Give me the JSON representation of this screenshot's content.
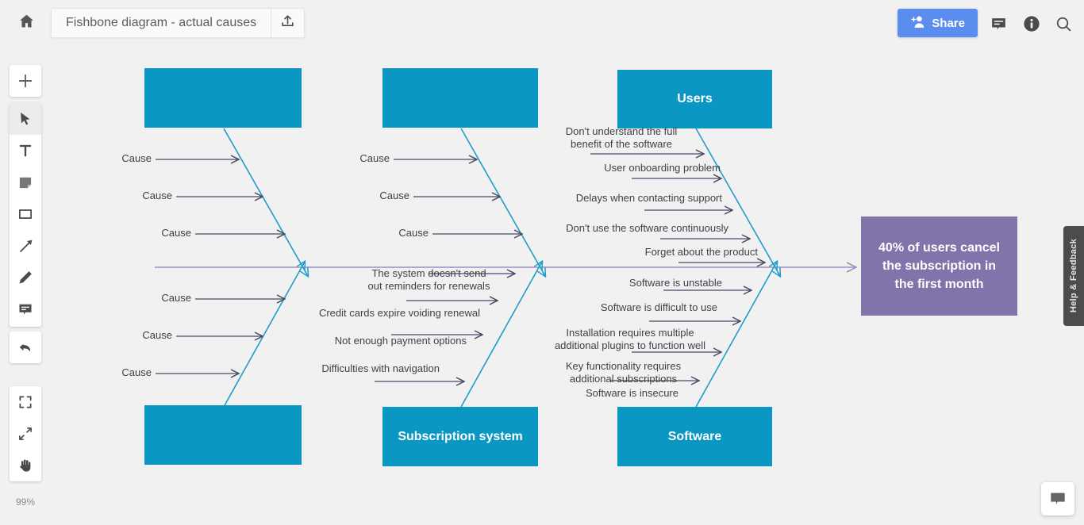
{
  "app": {
    "home_icon": "home-icon",
    "title": "Fishbone diagram - actual causes",
    "export_icon": "export-icon",
    "share_label": "Share",
    "share_icon": "add-person-icon",
    "comment_icon": "comment-icon",
    "info_icon": "info-icon",
    "search_icon": "search-icon",
    "accent_blue": "#5b8def"
  },
  "toolbar": {
    "add": {
      "name": "add-icon",
      "label": "+"
    },
    "tools": [
      {
        "name": "select-cursor-icon",
        "active": true
      },
      {
        "name": "text-tool-icon",
        "active": false
      },
      {
        "name": "sticky-note-icon",
        "active": false
      },
      {
        "name": "rectangle-shape-icon",
        "active": false
      },
      {
        "name": "arrow-tool-icon",
        "active": false
      },
      {
        "name": "pencil-tool-icon",
        "active": false
      },
      {
        "name": "comment-tool-icon",
        "active": false
      }
    ],
    "undo": {
      "name": "undo-icon"
    },
    "view": [
      {
        "name": "fit-to-screen-icon"
      },
      {
        "name": "expand-icon"
      },
      {
        "name": "pan-hand-icon"
      }
    ],
    "zoom_level": "99%"
  },
  "panels": {
    "help_tab": "Help & Feedback",
    "chat_fab_icon": "chat-bubble-icon"
  },
  "diagram": {
    "colors": {
      "category_box": "#0b97c4",
      "effect_box": "#8274ab",
      "bone": "#1e9dc8",
      "spine": "#9b8fc4",
      "cause_arrow": "#4a4a66"
    },
    "spine_label": "",
    "effect": {
      "text": "40% of users cancel the subscription in the first month",
      "lines": [
        "40% of users cancel",
        "the subscription in",
        "the first month"
      ]
    },
    "categories": [
      {
        "id": "top-left",
        "title": "",
        "position": "top",
        "causes": [
          "Cause",
          "Cause",
          "Cause"
        ]
      },
      {
        "id": "top-middle",
        "title": "",
        "position": "top",
        "causes": [
          "Cause",
          "Cause",
          "Cause"
        ]
      },
      {
        "id": "users",
        "title": "Users",
        "position": "top",
        "causes": [
          "Don't understand the full\nbenefit of the software",
          "User onboarding problem",
          "Delays when contacting support",
          "Don't use the software continuously",
          "Forget about the product"
        ]
      },
      {
        "id": "bottom-left",
        "title": "",
        "position": "bottom",
        "causes": [
          "Cause",
          "Cause",
          "Cause"
        ]
      },
      {
        "id": "subscription-system",
        "title": "Subscription system",
        "position": "bottom",
        "causes": [
          "The system doesn't send\nout reminders for renewals",
          "Credit cards expire voiding renewal",
          "Not enough payment options",
          "Difficulties with navigation"
        ]
      },
      {
        "id": "software",
        "title": "Software",
        "position": "bottom",
        "causes": [
          "Software is unstable",
          "Software is difficult to use",
          "Installation requires multiple\nadditional plugins to function well",
          "Key functionality requires\nadditional subscriptions",
          "Software is insecure"
        ]
      }
    ]
  }
}
